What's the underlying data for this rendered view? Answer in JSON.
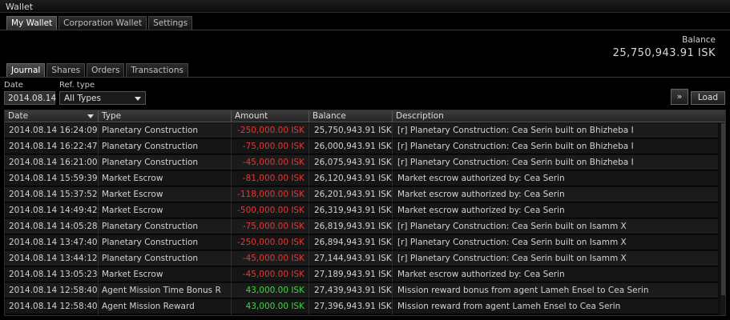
{
  "window": {
    "title": "Wallet"
  },
  "top_tabs": [
    {
      "label": "My Wallet",
      "active": true
    },
    {
      "label": "Corporation Wallet",
      "active": false
    },
    {
      "label": "Settings",
      "active": false
    }
  ],
  "balance": {
    "label": "Balance",
    "value": "25,750,943.91 ISK"
  },
  "sub_tabs": [
    {
      "label": "Journal",
      "active": true
    },
    {
      "label": "Shares",
      "active": false
    },
    {
      "label": "Orders",
      "active": false
    },
    {
      "label": "Transactions",
      "active": false
    }
  ],
  "filters": {
    "date_label": "Date",
    "date_value": "2014.08.14",
    "ref_type_label": "Ref. type",
    "ref_type_value": "All Types"
  },
  "buttons": {
    "forward_icon": "double-chevron-right-icon",
    "load_label": "Load"
  },
  "table": {
    "columns": [
      "Date",
      "Type",
      "Amount",
      "Balance",
      "Description"
    ],
    "rows": [
      {
        "date": "2014.08.14 16:24:09",
        "type": "Planetary Construction",
        "amount": "-250,000.00 ISK",
        "sign": "neg",
        "balance": "25,750,943.91 ISK",
        "description": "[r] Planetary Construction: Cea Serin built on Bhizheba I"
      },
      {
        "date": "2014.08.14 16:22:47",
        "type": "Planetary Construction",
        "amount": "-75,000.00 ISK",
        "sign": "neg",
        "balance": "26,000,943.91 ISK",
        "description": "[r] Planetary Construction: Cea Serin built on Bhizheba I"
      },
      {
        "date": "2014.08.14 16:21:00",
        "type": "Planetary Construction",
        "amount": "-45,000.00 ISK",
        "sign": "neg",
        "balance": "26,075,943.91 ISK",
        "description": "[r] Planetary Construction: Cea Serin built on Bhizheba I"
      },
      {
        "date": "2014.08.14 15:59:39",
        "type": "Market Escrow",
        "amount": "-81,000.00 ISK",
        "sign": "neg",
        "balance": "26,120,943.91 ISK",
        "description": "Market escrow authorized by: Cea Serin"
      },
      {
        "date": "2014.08.14 15:37:52",
        "type": "Market Escrow",
        "amount": "-118,000.00 ISK",
        "sign": "neg",
        "balance": "26,201,943.91 ISK",
        "description": "Market escrow authorized by: Cea Serin"
      },
      {
        "date": "2014.08.14 14:49:42",
        "type": "Market Escrow",
        "amount": "-500,000.00 ISK",
        "sign": "neg",
        "balance": "26,319,943.91 ISK",
        "description": "Market escrow authorized by: Cea Serin"
      },
      {
        "date": "2014.08.14 14:05:28",
        "type": "Planetary Construction",
        "amount": "-75,000.00 ISK",
        "sign": "neg",
        "balance": "26,819,943.91 ISK",
        "description": "[r] Planetary Construction: Cea Serin built on Isamm X"
      },
      {
        "date": "2014.08.14 13:47:40",
        "type": "Planetary Construction",
        "amount": "-250,000.00 ISK",
        "sign": "neg",
        "balance": "26,894,943.91 ISK",
        "description": "[r] Planetary Construction: Cea Serin built on Isamm X"
      },
      {
        "date": "2014.08.14 13:44:12",
        "type": "Planetary Construction",
        "amount": "-45,000.00 ISK",
        "sign": "neg",
        "balance": "27,144,943.91 ISK",
        "description": "[r] Planetary Construction: Cea Serin built on Isamm X"
      },
      {
        "date": "2014.08.14 13:05:23",
        "type": "Market Escrow",
        "amount": "-45,000.00 ISK",
        "sign": "neg",
        "balance": "27,189,943.91 ISK",
        "description": "Market escrow authorized by: Cea Serin"
      },
      {
        "date": "2014.08.14 12:58:40",
        "type": "Agent Mission Time Bonus R",
        "amount": "43,000.00 ISK",
        "sign": "pos",
        "balance": "27,439,943.91 ISK",
        "description": "Mission reward bonus from agent Lameh Ensel to Cea Serin"
      },
      {
        "date": "2014.08.14 12:58:40",
        "type": "Agent Mission Reward",
        "amount": "43,000.00 ISK",
        "sign": "pos",
        "balance": "27,396,943.91 ISK",
        "description": "Mission reward from agent Lameh Ensel to Cea Serin"
      }
    ]
  },
  "colors": {
    "negative": "#e03a3a",
    "positive": "#3fd83f"
  }
}
